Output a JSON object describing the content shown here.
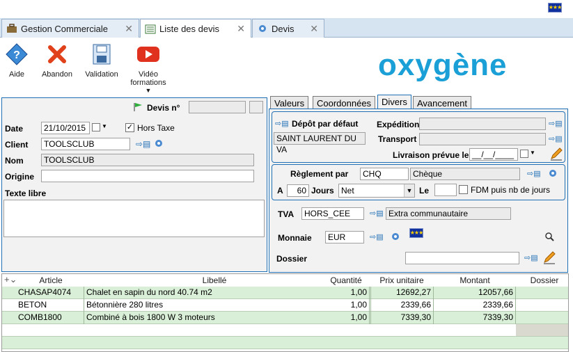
{
  "tabs": [
    {
      "label": "Gestion Commerciale",
      "icon": "briefcase-icon"
    },
    {
      "label": "Liste des devis",
      "icon": "list-icon"
    },
    {
      "label": "Devis",
      "icon": "gear-icon"
    }
  ],
  "toolbar": {
    "help_label": "Aide",
    "cancel_label": "Abandon",
    "validate_label": "Validation",
    "video_label_1": "Vidéo",
    "video_label_2": "formations"
  },
  "logo_text": "oxygène",
  "header": {
    "devis_label": "Devis n°",
    "devis_number": ""
  },
  "form": {
    "date_label": "Date",
    "date_value": "21/10/2015",
    "hors_taxe_label": "Hors Taxe",
    "client_label": "Client",
    "client_value": "TOOLSCLUB",
    "nom_label": "Nom",
    "nom_value": "TOOLSCLUB",
    "origine_label": "Origine",
    "origine_value": "",
    "texte_libre_label": "Texte libre",
    "texte_libre_value": ""
  },
  "right_tabs": [
    "Valeurs",
    "Coordonnées",
    "Divers",
    "Avancement"
  ],
  "divers": {
    "depot_label": "Dépôt par défaut",
    "depot_value": "SAINT LAURENT DU VA",
    "expedition_label": "Expédition",
    "transport_label": "Transport",
    "livraison_label": "Livraison prévue le",
    "livraison_value": "__/__/____",
    "reglement_label": "Règlement par",
    "reglement_code": "CHQ",
    "reglement_desc": "Chèque",
    "a_label": "A",
    "jours_value": "60",
    "jours_label": "Jours",
    "net_value": "Net",
    "le_label": "Le",
    "le_value": "",
    "fdm_label": "FDM puis nb de jours",
    "tva_label": "TVA",
    "tva_code": "HORS_CEE",
    "tva_desc": "Extra communautaire",
    "monnaie_label": "Monnaie",
    "monnaie_value": "EUR",
    "dossier_label": "Dossier",
    "dossier_value": ""
  },
  "grid": {
    "columns": [
      "Article",
      "Libellé",
      "Quantité",
      "Prix unitaire",
      "Montant",
      "Dossier"
    ],
    "rows": [
      {
        "article": "CHASAP4074",
        "libelle": "Chalet en sapin du nord 40.74 m2",
        "quantite": "1,00",
        "prix": "12692,27",
        "montant": "12057,66"
      },
      {
        "article": "BETON",
        "libelle": "Bétonnière 280 litres",
        "quantite": "1,00",
        "prix": "2339,66",
        "montant": "2339,66"
      },
      {
        "article": "COMB1800",
        "libelle": "Combiné à bois 1800 W 3 moteurs",
        "quantite": "1,00",
        "prix": "7339,30",
        "montant": "7339,30"
      }
    ]
  },
  "colors": {
    "accent": "#1f6fb5",
    "row_green": "#d9efd7",
    "logo": "#1a9fd6"
  }
}
